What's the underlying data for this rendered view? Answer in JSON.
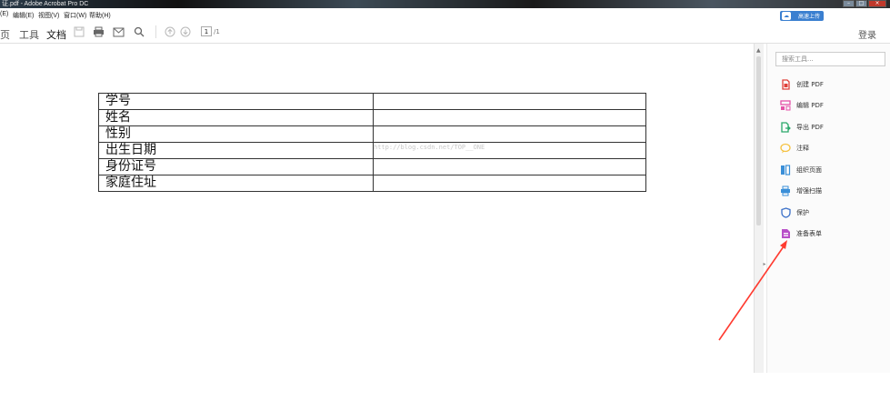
{
  "window": {
    "title": "证.pdf - Adobe Acrobat Pro DC"
  },
  "menu": {
    "items": [
      "(E)",
      "编辑(E)",
      "视图(V)",
      "窗口(W)",
      "帮助(H)"
    ]
  },
  "cloud_upload": {
    "label": "高速上传"
  },
  "toolbar": {
    "tabs": [
      "页",
      "工具",
      "文档"
    ],
    "active_tab": "文档",
    "page_number": "1",
    "page_total": "/1",
    "login": "登录"
  },
  "document": {
    "rows": [
      {
        "label": "学号",
        "value": ""
      },
      {
        "label": "姓名",
        "value": ""
      },
      {
        "label": "性别",
        "value": ""
      },
      {
        "label": "出生日期",
        "value": ""
      },
      {
        "label": "身份证号",
        "value": ""
      },
      {
        "label": "家庭住址",
        "value": ""
      }
    ],
    "watermark": "http://blog.csdn.net/TOP__ONE"
  },
  "sidebar": {
    "search_placeholder": "搜索工具...",
    "tools": [
      {
        "label": "创建 PDF",
        "icon": "create-pdf-icon",
        "color": "#e0413a"
      },
      {
        "label": "编辑 PDF",
        "icon": "edit-pdf-icon",
        "color": "#e452a8"
      },
      {
        "label": "导出 PDF",
        "icon": "export-pdf-icon",
        "color": "#2aa86a"
      },
      {
        "label": "注释",
        "icon": "comment-icon",
        "color": "#f5c242"
      },
      {
        "label": "组织页面",
        "icon": "organize-pages-icon",
        "color": "#3a8fd8"
      },
      {
        "label": "增强扫描",
        "icon": "scan-icon",
        "color": "#3a8fd8"
      },
      {
        "label": "保护",
        "icon": "protect-icon",
        "color": "#3a6fc8"
      },
      {
        "label": "准备表单",
        "icon": "prepare-form-icon",
        "color": "#b84fc8"
      }
    ]
  },
  "annotation": {
    "arrow_color": "#ff3b30"
  }
}
